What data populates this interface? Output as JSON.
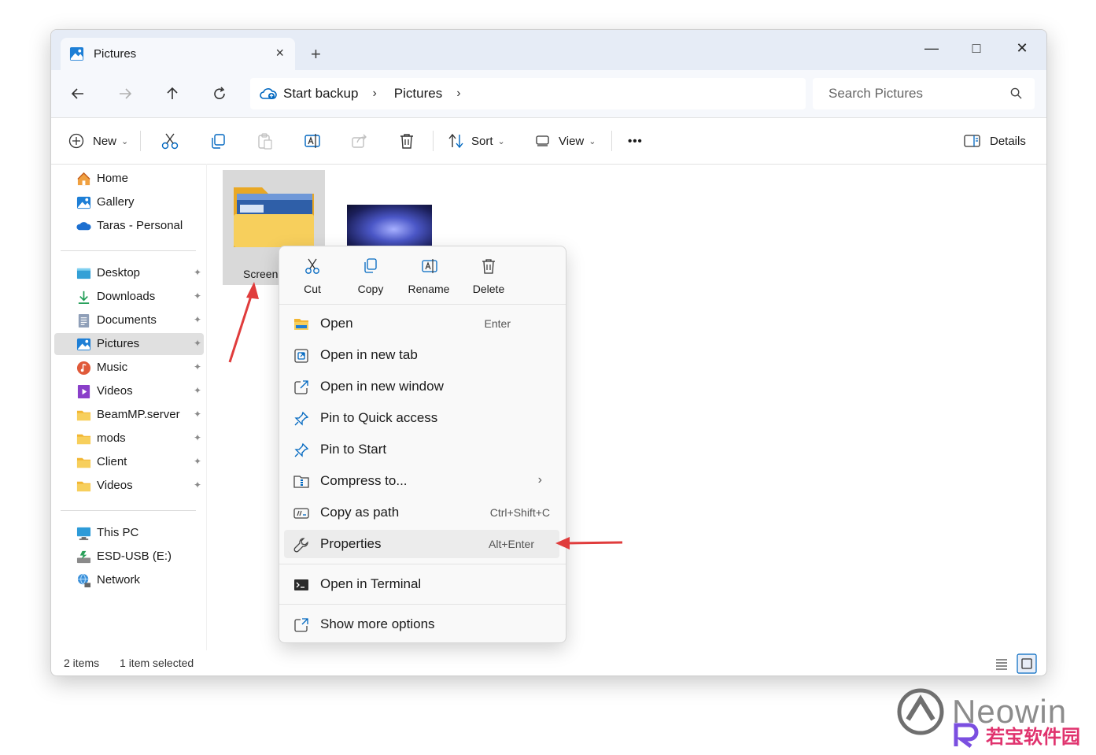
{
  "window": {
    "tab_title": "Pictures",
    "tab_close": "×",
    "new_tab": "+",
    "minimize": "—",
    "maximize": "□",
    "close": "✕"
  },
  "address": {
    "backup_label": "Start backup",
    "breadcrumbs": [
      "Pictures"
    ],
    "separator": "›"
  },
  "search": {
    "placeholder": "Search Pictures"
  },
  "toolbar": {
    "new_label": "New",
    "sort_label": "Sort",
    "view_label": "View",
    "more_label": "•••",
    "details_label": "Details",
    "chevron": "⌄"
  },
  "sidebar": {
    "top": [
      {
        "label": "Home",
        "icon": "home-icon"
      },
      {
        "label": "Gallery",
        "icon": "gallery-icon"
      },
      {
        "label": "Taras - Personal",
        "icon": "onedrive-icon"
      }
    ],
    "pinned": [
      {
        "label": "Desktop",
        "icon": "desktop-icon"
      },
      {
        "label": "Downloads",
        "icon": "downloads-icon"
      },
      {
        "label": "Documents",
        "icon": "documents-icon"
      },
      {
        "label": "Pictures",
        "icon": "pictures-icon",
        "selected": true
      },
      {
        "label": "Music",
        "icon": "music-icon"
      },
      {
        "label": "Videos",
        "icon": "videos-icon"
      },
      {
        "label": "BeamMP.server",
        "icon": "folder-icon"
      },
      {
        "label": "mods",
        "icon": "folder-icon"
      },
      {
        "label": "Client",
        "icon": "folder-icon"
      },
      {
        "label": "Videos",
        "icon": "folder-icon"
      }
    ],
    "bottom": [
      {
        "label": "This PC",
        "icon": "pc-icon"
      },
      {
        "label": "ESD-USB (E:)",
        "icon": "usb-drive-icon"
      },
      {
        "label": "Network",
        "icon": "network-icon"
      }
    ],
    "pin_glyph": "📌"
  },
  "content": {
    "folder_label": "Screen"
  },
  "status": {
    "items": "2 items",
    "selected": "1 item selected"
  },
  "context_menu": {
    "quick_actions": [
      {
        "label": "Cut",
        "icon": "cut-icon"
      },
      {
        "label": "Copy",
        "icon": "copy-icon"
      },
      {
        "label": "Rename",
        "icon": "rename-icon"
      },
      {
        "label": "Delete",
        "icon": "delete-icon"
      }
    ],
    "items": [
      {
        "label": "Open",
        "shortcut": "Enter",
        "icon": "folder-open-icon"
      },
      {
        "label": "Open in new tab",
        "shortcut": "",
        "icon": "new-tab-icon"
      },
      {
        "label": "Open in new window",
        "shortcut": "",
        "icon": "new-window-icon"
      },
      {
        "label": "Pin to Quick access",
        "shortcut": "",
        "icon": "pin-icon"
      },
      {
        "label": "Pin to Start",
        "shortcut": "",
        "icon": "pin-icon"
      },
      {
        "label": "Compress to...",
        "shortcut": "",
        "icon": "compress-icon",
        "submenu": "›"
      },
      {
        "label": "Copy as path",
        "shortcut": "Ctrl+Shift+C",
        "icon": "copy-path-icon"
      },
      {
        "label": "Properties",
        "shortcut": "Alt+Enter",
        "icon": "wrench-icon"
      }
    ],
    "terminal": {
      "label": "Open in Terminal",
      "icon": "terminal-icon"
    },
    "more": {
      "label": "Show more options",
      "icon": "more-options-icon"
    }
  },
  "watermark": {
    "text": "Neowin",
    "cn_text": "若宝软件园"
  },
  "colors": {
    "accent": "#0067c0",
    "annotation_red": "#e03c3c",
    "folder_yellow": "#f7c948"
  }
}
